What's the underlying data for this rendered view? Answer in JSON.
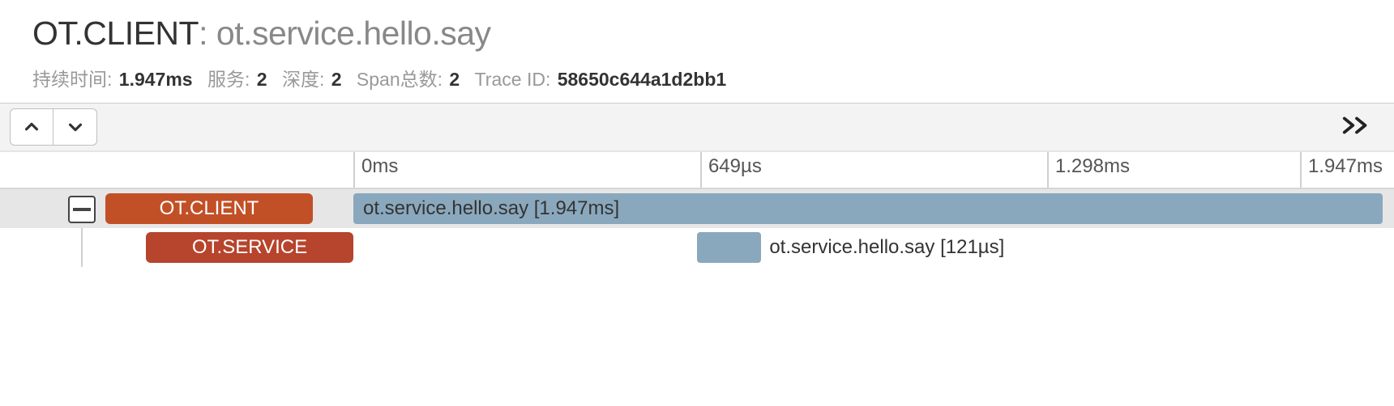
{
  "header": {
    "service_name": "OT.CLIENT",
    "colon": ": ",
    "operation": "ot.service.hello.say"
  },
  "stats": {
    "duration_label": "持续时间:",
    "duration_value": "1.947ms",
    "services_label": "服务:",
    "services_value": "2",
    "depth_label": "深度:",
    "depth_value": "2",
    "span_total_label": "Span总数:",
    "span_total_value": "2",
    "trace_id_label": "Trace ID:",
    "trace_id_value": "58650c644a1d2bb1"
  },
  "ticks": {
    "t0": "0ms",
    "t1": "649µs",
    "t2": "1.298ms",
    "t3": "1.947ms"
  },
  "spans": {
    "row0": {
      "service": "OT.CLIENT",
      "bar_label": "ot.service.hello.say [1.947ms]"
    },
    "row1": {
      "service": "OT.SERVICE",
      "bar_label": "ot.service.hello.say [121µs]"
    }
  },
  "colors": {
    "client_pill": "#c25027",
    "service_pill": "#b7442c",
    "span_bar": "#8aa8bd"
  }
}
